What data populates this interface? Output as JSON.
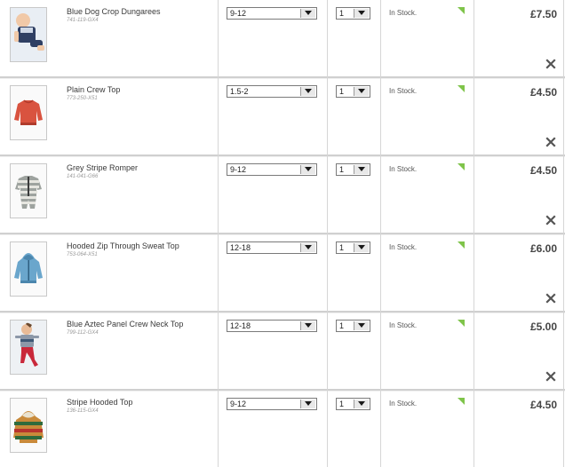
{
  "basket": {
    "items": [
      {
        "name": "Blue Dog Crop Dungarees",
        "code": "741-119-GX4",
        "size": "9-12",
        "quantity": "1",
        "stock": "In Stock.",
        "price": "£7.50",
        "image": "baby-in-dungarees"
      },
      {
        "name": "Plain Crew Top",
        "code": "773-250-X51",
        "size": "1.5-2",
        "quantity": "1",
        "stock": "In Stock.",
        "price": "£4.50",
        "image": "red-sweatshirt"
      },
      {
        "name": "Grey Stripe Romper",
        "code": "141-041-G66",
        "size": "9-12",
        "quantity": "1",
        "stock": "In Stock.",
        "price": "£4.50",
        "image": "striped-romper"
      },
      {
        "name": "Hooded Zip Through Sweat Top",
        "code": "753-064-X51",
        "size": "12-18",
        "quantity": "1",
        "stock": "In Stock.",
        "price": "£6.00",
        "image": "blue-zip-hoodie"
      },
      {
        "name": "Blue Aztec Panel Crew Neck Top",
        "code": "799-112-GX4",
        "size": "12-18",
        "quantity": "1",
        "stock": "In Stock.",
        "price": "£5.00",
        "image": "child-in-crew-top"
      },
      {
        "name": "Stripe Hooded Top",
        "code": "136-115-GX4",
        "size": "9-12",
        "quantity": "1",
        "stock": "In Stock.",
        "price": "£4.50",
        "image": "striped-hoodie"
      }
    ],
    "icons": {
      "dropdown": "chevron-down-icon",
      "remove": "close-icon",
      "stock_flag": "corner-flag-icon"
    },
    "colors": {
      "stock_flag": "#7fc44a",
      "border": "#d0d0d0",
      "price_text": "#444444"
    }
  }
}
